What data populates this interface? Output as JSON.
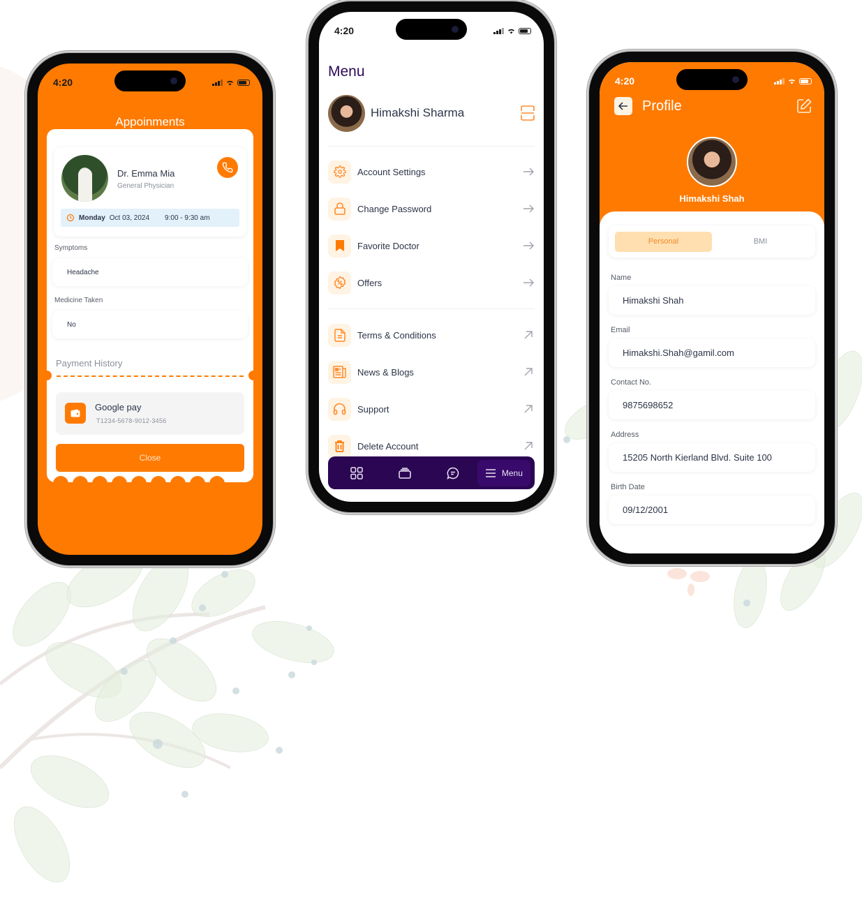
{
  "colors": {
    "accent": "#ff7a00",
    "navy": "#2b0653",
    "text": "#2c3447",
    "muted": "#8a8f99",
    "icon_bg": "#fff3e3",
    "appt_bg": "#e3f1fb",
    "seg_active_bg": "#ffdfb0"
  },
  "appointment_screen": {
    "status_time": "4:20",
    "title": "Appoinments",
    "doctor": {
      "name": "Dr. Emma Mia",
      "specialty": "General Physician"
    },
    "schedule": {
      "day": "Monday",
      "date": "Oct 03, 2024",
      "time": "9:00 - 9:30 am"
    },
    "fields": [
      {
        "label": "Symptoms",
        "value": "Headache"
      },
      {
        "label": "Medicine Taken",
        "value": "No"
      }
    ],
    "payment_history_title": "Payment History",
    "payment": {
      "method": "Google pay",
      "transaction_id": "T1234-5678-9012-3456"
    },
    "close_label": "Close"
  },
  "menu_screen": {
    "status_time": "4:20",
    "title": "Menu",
    "user_name": "Himakshi Sharma",
    "items": [
      {
        "label": "Account Settings",
        "icon": "gear-icon",
        "arrow": "arrow-right-icon"
      },
      {
        "label": "Change Password",
        "icon": "lock-icon",
        "arrow": "arrow-right-icon"
      },
      {
        "label": "Favorite Doctor",
        "icon": "bookmark-icon",
        "arrow": "arrow-right-icon"
      },
      {
        "label": "Offers",
        "icon": "discount-badge-icon",
        "arrow": "arrow-right-icon"
      },
      {
        "label": "Terms & Conditions",
        "icon": "document-icon",
        "arrow": "arrow-up-right-icon"
      },
      {
        "label": "News & Blogs",
        "icon": "newspaper-icon",
        "arrow": "arrow-up-right-icon"
      },
      {
        "label": "Support",
        "icon": "headphones-icon",
        "arrow": "arrow-up-right-icon"
      },
      {
        "label": "Delete Account",
        "icon": "trash-icon",
        "arrow": "arrow-up-right-icon"
      }
    ],
    "tabbar": [
      {
        "icon": "grid-icon",
        "label": ""
      },
      {
        "icon": "cards-icon",
        "label": ""
      },
      {
        "icon": "chat-icon",
        "label": ""
      },
      {
        "icon": "hamburger-icon",
        "label": "Menu",
        "active": true
      }
    ]
  },
  "profile_screen": {
    "status_time": "4:20",
    "title": "Profile",
    "user_name": "Himakshi Shah",
    "tabs": [
      {
        "label": "Personal",
        "active": true
      },
      {
        "label": "BMI",
        "active": false
      }
    ],
    "fields": [
      {
        "label": "Name",
        "value": "Himakshi Shah"
      },
      {
        "label": "Email",
        "value": "Himakshi.Shah@gamil.com"
      },
      {
        "label": "Contact No.",
        "value": "9875698652"
      },
      {
        "label": "Address",
        "value": "15205 North Kierland Blvd. Suite 100"
      },
      {
        "label": "Birth Date",
        "value": "09/12/2001"
      }
    ]
  }
}
